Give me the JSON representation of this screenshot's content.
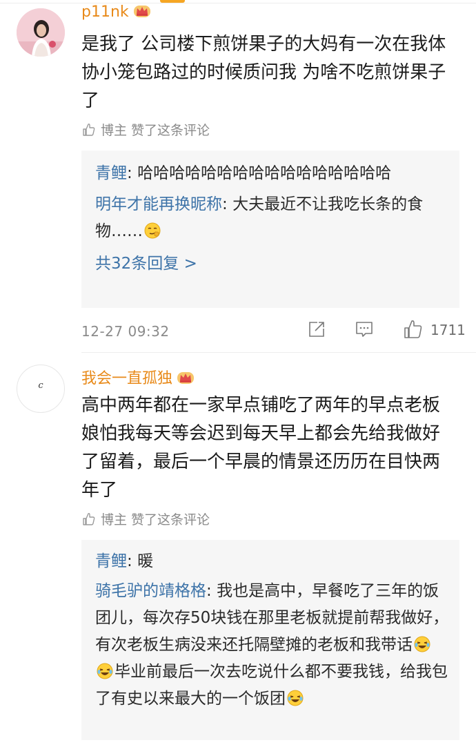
{
  "comments": [
    {
      "username": "p11nk",
      "text": "是我了 公司楼下煎饼果子的大妈有一次在我体协小笼包路过的时候质问我 为啥不吃煎饼果子了",
      "liked_by_author": "博主 赞了这条评论",
      "replies": [
        {
          "name": "青鲤",
          "separator": ": ",
          "text": "哈哈哈哈哈哈哈哈哈哈哈哈哈哈哈哈"
        },
        {
          "name": "明年才能再换昵称",
          "separator": ": ",
          "text": "大夫最近不让我吃长条的食物……"
        }
      ],
      "more_replies": "共32条回复 >",
      "timestamp": "12-27 09:32",
      "like_count": "1711"
    },
    {
      "username": "我会一直孤独",
      "avatar_letter": "c",
      "text": "高中两年都在一家早点铺吃了两年的早点老板娘怕我每天等会迟到每天早上都会先给我做好了留着，最后一个早晨的情景还历历在目快两年了",
      "liked_by_author": "博主 赞了这条评论",
      "replies": [
        {
          "name": "青鲤",
          "separator": ": ",
          "text": "暖"
        },
        {
          "name": "骑毛驴的靖格格",
          "separator": ": ",
          "text_part1": "我也是高中，早餐吃了三年的饭团儿，每次存50块钱在那里老板就提前帮我做好，有次老板生病没来还托隔壁摊的老板和我带话",
          "text_part2": "毕业前最后一次去吃说什么都不要我钱，给我包了有史以来最大的一个饭团"
        }
      ]
    }
  ],
  "icons": {
    "crown": "crown-badge-icon",
    "thumb": "thumb-up-icon",
    "share": "share-icon",
    "reply": "comment-icon",
    "like": "like-icon",
    "emoji_smirk": "smirk-emoji",
    "emoji_laugh": "laughing-tears-emoji"
  },
  "colors": {
    "username": "#e88a1a",
    "reply_name": "#3d73a8",
    "muted": "#8a8a8a",
    "reply_bg": "#f6f6f6"
  }
}
